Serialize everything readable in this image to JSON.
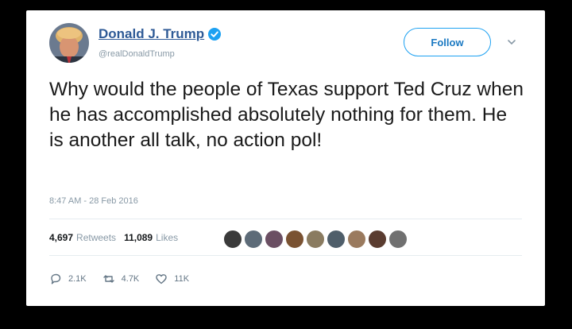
{
  "tweet": {
    "display_name": "Donald J. Trump",
    "handle": "@realDonaldTrump",
    "follow_label": "Follow",
    "text": "Why would the people of Texas support Ted Cruz when he has accomplished absolutely nothing for them. He is another all talk, no action pol!",
    "timestamp": "8:47 AM - 28 Feb 2016",
    "retweets_count": "4,697",
    "retweets_label": "Retweets",
    "likes_count": "11,089",
    "likes_label": "Likes"
  },
  "actions": {
    "reply_count": "2.1K",
    "retweet_count": "4.7K",
    "like_count": "11K"
  },
  "colors": {
    "name": "#2e5a96",
    "verified": "#1da1f2",
    "follow_border": "#1da1f2",
    "muted": "#8899a6"
  },
  "icons": [
    "verified-badge-icon",
    "chevron-down-icon",
    "reply-icon",
    "retweet-icon",
    "heart-icon"
  ]
}
